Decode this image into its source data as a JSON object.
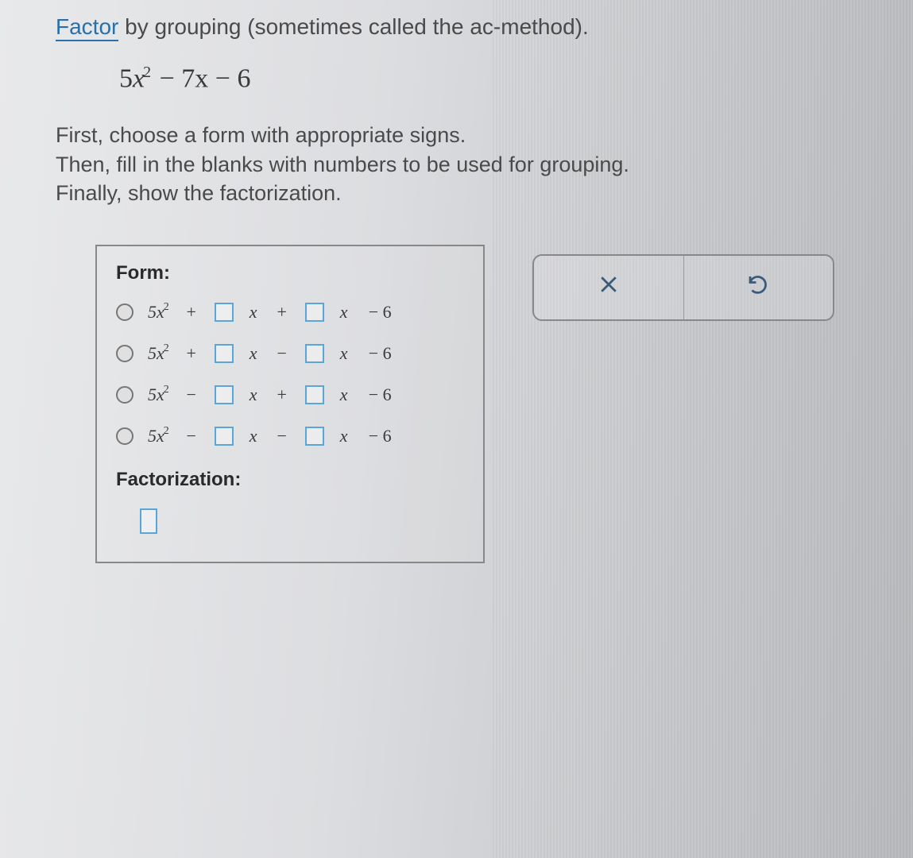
{
  "intro": {
    "link_text": "Factor",
    "rest": " by grouping (sometimes called the ac-method)."
  },
  "equation": {
    "coef": "5",
    "var": "x",
    "sup": "2",
    "rest": " − 7x − 6"
  },
  "instructions": {
    "l1": "First, choose a form with appropriate signs.",
    "l2": "Then, fill in the blanks with numbers to be used for grouping.",
    "l3": "Finally, show the factorization."
  },
  "form": {
    "title": "Form:",
    "lead_coef": "5",
    "lead_var": "x",
    "lead_sup": "2",
    "xvar": "x",
    "tail": "− 6",
    "options": [
      {
        "sign1": "+",
        "sign2": "+"
      },
      {
        "sign1": "+",
        "sign2": "−"
      },
      {
        "sign1": "−",
        "sign2": "+"
      },
      {
        "sign1": "−",
        "sign2": "−"
      }
    ],
    "fact_title": "Factorization:"
  },
  "actions": {
    "clear": "×",
    "undo": "↶"
  }
}
